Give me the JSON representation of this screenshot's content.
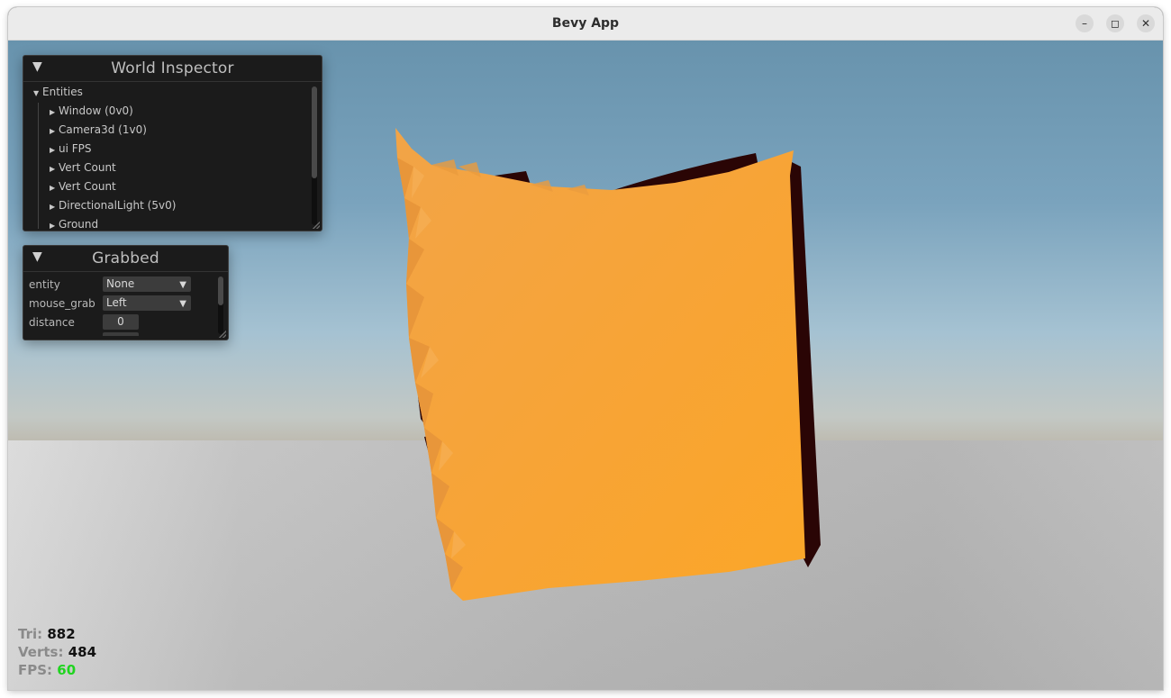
{
  "window": {
    "title": "Bevy App",
    "minimize_icon": "minimize-icon",
    "maximize_icon": "maximize-icon",
    "close_icon": "close-icon"
  },
  "world_inspector": {
    "title": "World Inspector",
    "root_label": "Entities",
    "entities": [
      "Window (0v0)",
      "Camera3d (1v0)",
      "ui FPS",
      "Vert Count",
      "Vert Count",
      "DirectionalLight (5v0)",
      "Ground"
    ]
  },
  "grabbed": {
    "title": "Grabbed",
    "fields": {
      "entity_label": "entity",
      "entity_value": "None",
      "mouse_grab_label": "mouse_grab",
      "mouse_grab_value": "Left",
      "distance_label": "distance",
      "distance_value": "0"
    }
  },
  "stats": {
    "tri_label": "Tri:",
    "tri_value": "882",
    "verts_label": "Verts:",
    "verts_value": "484",
    "fps_label": "FPS:",
    "fps_value": "60"
  },
  "colors": {
    "cloth": "#f9a12f",
    "cloth_back": "#2a0505",
    "fps_value": "#1fd41f",
    "panel_bg": "#1b1b1b"
  }
}
